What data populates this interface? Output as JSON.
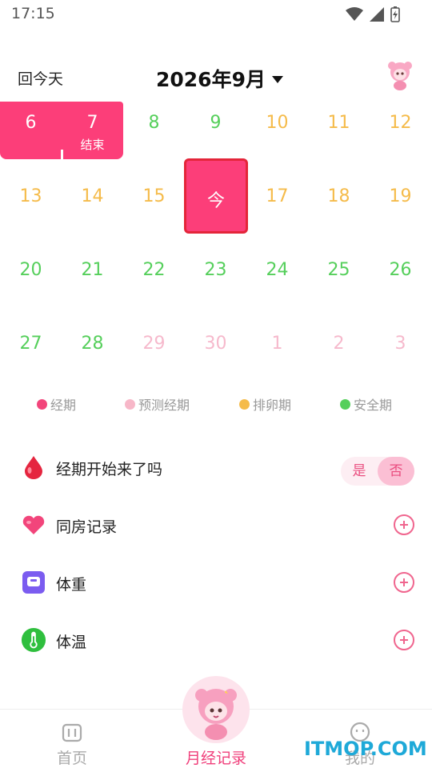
{
  "status_bar": {
    "time": "17:15"
  },
  "header": {
    "today_button": "回今天",
    "month_title": "2026年9月"
  },
  "calendar": {
    "period_days": [
      {
        "num": "6",
        "sub": ""
      },
      {
        "num": "7",
        "sub": "结束"
      }
    ],
    "week1_rest": [
      {
        "num": "8",
        "color": "green"
      },
      {
        "num": "9",
        "color": "green"
      },
      {
        "num": "10",
        "color": "orange"
      },
      {
        "num": "11",
        "color": "orange"
      },
      {
        "num": "12",
        "color": "orange"
      }
    ],
    "week2": [
      {
        "num": "13",
        "color": "orange"
      },
      {
        "num": "14",
        "color": "orange"
      },
      {
        "num": "15",
        "color": "orange"
      },
      {
        "num": "17",
        "color": "orange"
      },
      {
        "num": "18",
        "color": "orange"
      },
      {
        "num": "19",
        "color": "orange"
      }
    ],
    "today_label": "今",
    "week3": [
      "20",
      "21",
      "22",
      "23",
      "24",
      "25",
      "26"
    ],
    "week4": [
      {
        "num": "27",
        "color": "green"
      },
      {
        "num": "28",
        "color": "green"
      },
      {
        "num": "29",
        "color": "lpink"
      },
      {
        "num": "30",
        "color": "lpink"
      },
      {
        "num": "1",
        "color": "lpink"
      },
      {
        "num": "2",
        "color": "lpink"
      },
      {
        "num": "3",
        "color": "lpink"
      }
    ]
  },
  "legend": [
    {
      "label": "经期",
      "color": "#f2457b"
    },
    {
      "label": "预测经期",
      "color": "#f7b7c8"
    },
    {
      "label": "排卵期",
      "color": "#f5bb4a"
    },
    {
      "label": "安全期",
      "color": "#55cf5b"
    }
  ],
  "records": {
    "period_started": {
      "label": "经期开始来了吗",
      "yes": "是",
      "no": "否",
      "selected": "否"
    },
    "intimacy": {
      "label": "同房记录"
    },
    "weight": {
      "label": "体重"
    },
    "temperature": {
      "label": "体温"
    }
  },
  "tabbar": {
    "home": "首页",
    "record": "月经记录",
    "mine": "我的"
  },
  "watermark": "ITMOP.COM",
  "colors": {
    "accent": "#fc3e79",
    "today_border": "#e4253a",
    "green": "#55cf5b",
    "orange": "#f5bb4a",
    "light_pink": "#f6b9cc"
  }
}
